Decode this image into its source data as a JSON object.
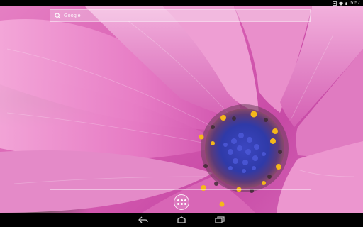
{
  "status_bar": {
    "time": "5:57",
    "icons": [
      "screenshot-icon",
      "wifi-icon",
      "battery-icon"
    ]
  },
  "wallpaper": {
    "subject": "pink-daisy-flower",
    "colors": {
      "petal": "#e07ec0",
      "petal_dark": "#c84aa5",
      "center_blue": "#3e46b8",
      "pollen": "#f4b81c",
      "leaf": "#3f7a3c"
    }
  },
  "search": {
    "label": "Google"
  },
  "dock": {
    "all_apps_icon": "all-apps-icon"
  },
  "nav_bar": {
    "buttons": [
      "back-icon",
      "home-icon",
      "recents-icon"
    ]
  }
}
